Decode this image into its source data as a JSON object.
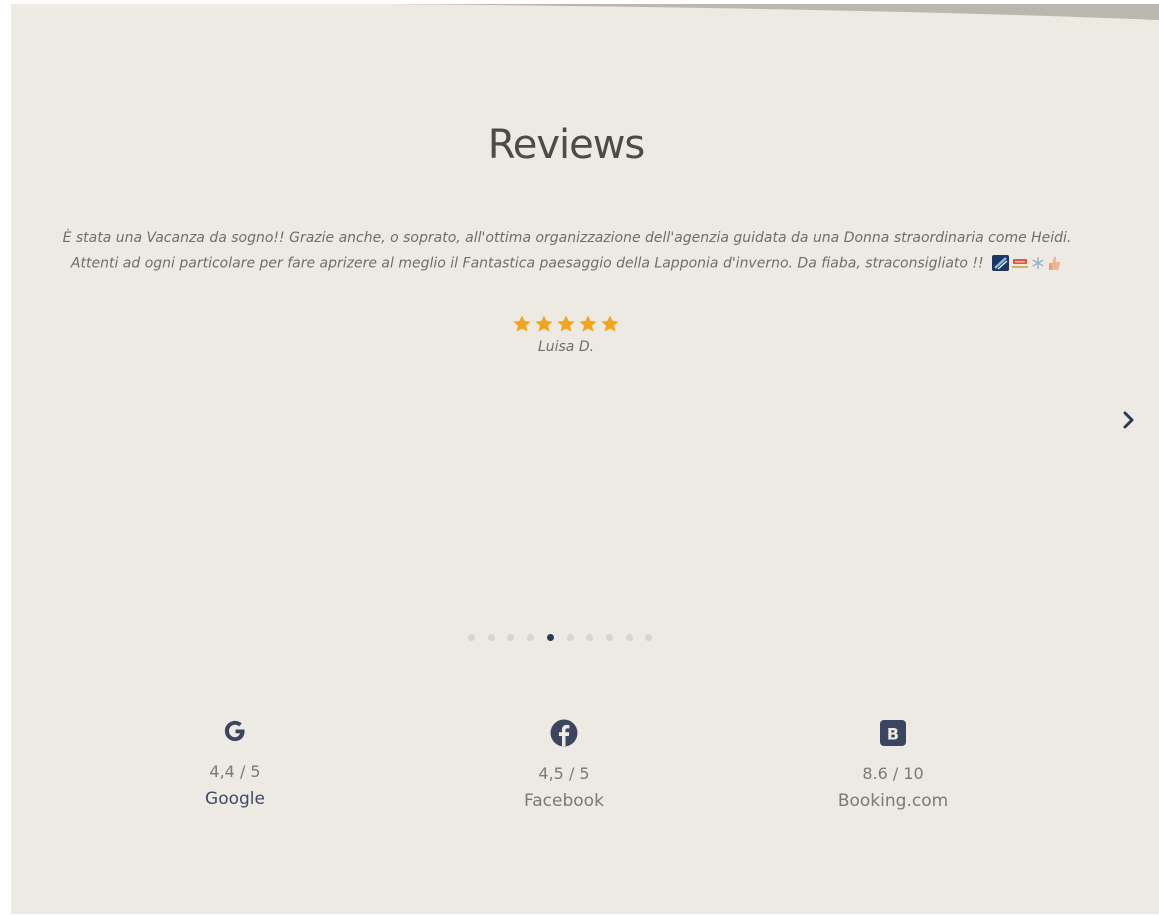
{
  "section": {
    "title": "Reviews"
  },
  "review": {
    "text": "È stata una Vacanza da sogno!! Grazie anche, o soprato, all'ottima organizzazione dell'agenzia guidata da una Donna straordinaria come Heidi. Attenti ad ogni particolare per fare aprizere al meglio il Fantastica paesaggio della Lapponia d'inverno. Da fiaba, straconsigliato !!",
    "emoji_icons": [
      "ski-icon",
      "sled-icon",
      "snowflake-icon",
      "thumbs-up-icon"
    ],
    "rating": 5,
    "rating_max": 5,
    "author": "Luisa D."
  },
  "carousel": {
    "slide_count": 10,
    "active_index": 4,
    "next_icon": "chevron-right-icon"
  },
  "platforms": [
    {
      "icon": "google-icon",
      "score": "4,4 / 5",
      "name": "Google",
      "name_color": "#3f4a66"
    },
    {
      "icon": "facebook-icon",
      "score": "4,5 / 5",
      "name": "Facebook",
      "name_color": "#7b7a74"
    },
    {
      "icon": "booking-icon",
      "score": "8.6 / 10",
      "name": "Booking.com",
      "name_color": "#7b7a74"
    }
  ],
  "colors": {
    "background": "#eceae2",
    "star": "#f2a41c",
    "icon": "#3b4560",
    "active_dot": "#2c3a5a"
  }
}
